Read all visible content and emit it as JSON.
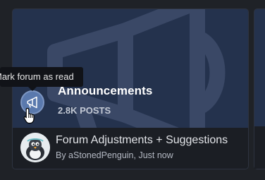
{
  "forum": {
    "title": "Announcements",
    "post_count": "2.8K POSTS",
    "icon": "megaphone-icon"
  },
  "tooltip": {
    "text": "Mark forum as read"
  },
  "latest_thread": {
    "title": "Forum Adjustments + Suggestions",
    "meta": "By aStonedPenguin, Just now",
    "avatar": "penguin-avatar"
  },
  "colors": {
    "hero_bg": "#24324d",
    "icon_bg": "#5a79ad",
    "footer_bg": "#1b1e24",
    "tooltip_bg": "#111318"
  }
}
